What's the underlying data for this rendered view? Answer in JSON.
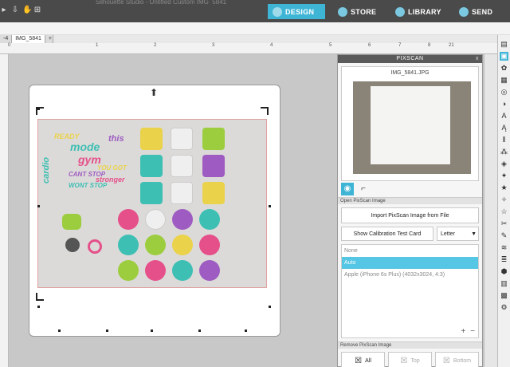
{
  "app": {
    "faded_title": "Silhouette Studio - Untitled Custom IMG_5841"
  },
  "nav": {
    "design": "DESIGN",
    "store": "STORE",
    "library": "LIBRARY",
    "send": "SEND"
  },
  "tabs": {
    "prev": "-4",
    "current": "IMG_5841",
    "add": "+"
  },
  "ruler": {
    "ticks": [
      "0",
      "1",
      "2",
      "3",
      "4",
      "5",
      "6",
      "7",
      "8",
      "21"
    ]
  },
  "panel": {
    "title": "PIXSCAN",
    "close": "x",
    "preview_filename": "IMG_5841.JPG",
    "open_section": "Open PixScan Image",
    "import_button": "Import PixScan Image from File",
    "calibration_button": "Show Calibration Test Card",
    "paper_size": "Letter",
    "cameras": [
      {
        "label": "None",
        "selected": false
      },
      {
        "label": "Auto",
        "selected": true
      },
      {
        "label": "Apple (iPhone 6s Plus) (4032x3024, 4:3)",
        "selected": false
      }
    ],
    "list_add": "+",
    "list_remove": "−",
    "remove_section": "Remove PixScan Image",
    "remove_all": "All",
    "remove_top": "Top",
    "remove_bottom": "Bottom"
  },
  "photo_text": {
    "cardio": "cardio",
    "mode": "mode",
    "gym": "gym",
    "cant_stop": "CANT STOP",
    "wont_stop": "WONT STOP",
    "stronger": "stronger",
    "ready": "READY",
    "you_got": "YOU GOT",
    "this": "this"
  },
  "colors": {
    "accent": "#3fb5d6",
    "selected_row": "#55c6e3",
    "topbar": "#4a4a4a",
    "canvas_bg": "#c8c8c8",
    "sticker_yellow": "#ead24a",
    "sticker_teal": "#3dbfb4",
    "sticker_purple": "#9e5bc2",
    "sticker_pink": "#e5508a",
    "sticker_green": "#9ccd3e",
    "sticker_orange": "#f08a3a"
  }
}
